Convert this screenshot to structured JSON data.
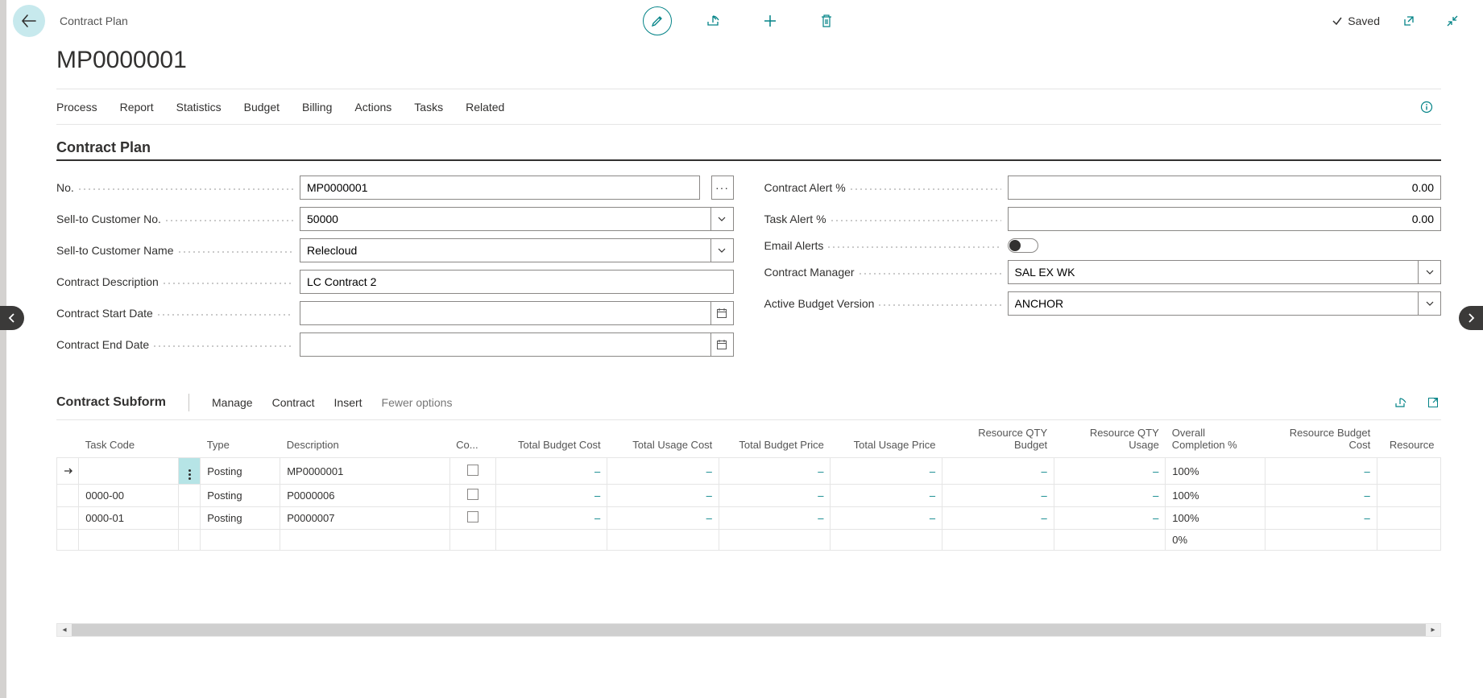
{
  "header": {
    "breadcrumb": "Contract Plan",
    "title": "MP0000001",
    "saved_label": "Saved"
  },
  "tabs": [
    "Process",
    "Report",
    "Statistics",
    "Budget",
    "Billing",
    "Actions",
    "Tasks",
    "Related"
  ],
  "section_title": "Contract Plan",
  "fields": {
    "no_label": "No.",
    "no_value": "MP0000001",
    "sell_to_no_label": "Sell-to Customer No.",
    "sell_to_no_value": "50000",
    "sell_to_name_label": "Sell-to Customer Name",
    "sell_to_name_value": "Relecloud",
    "desc_label": "Contract Description",
    "desc_value": "LC Contract 2",
    "start_label": "Contract Start Date",
    "start_value": "",
    "end_label": "Contract End Date",
    "end_value": "",
    "alert_label": "Contract Alert %",
    "alert_value": "0.00",
    "task_alert_label": "Task Alert %",
    "task_alert_value": "0.00",
    "email_label": "Email Alerts",
    "manager_label": "Contract Manager",
    "manager_value": "SAL EX WK",
    "budget_label": "Active Budget Version",
    "budget_value": "ANCHOR"
  },
  "subform": {
    "title": "Contract Subform",
    "actions": {
      "manage": "Manage",
      "contract": "Contract",
      "insert": "Insert",
      "fewer": "Fewer options"
    },
    "columns": {
      "task_code": "Task Code",
      "type": "Type",
      "description": "Description",
      "co": "Co...",
      "tbc": "Total Budget Cost",
      "tuc": "Total Usage Cost",
      "tbp": "Total Budget Price",
      "tup": "Total Usage Price",
      "rqb": "Resource QTY Budget",
      "rqu": "Resource QTY Usage",
      "ocp": "Overall Completion %",
      "rbc": "Resource Budget Cost",
      "res": "Resource"
    },
    "rows": [
      {
        "task_code": "",
        "type": "Posting",
        "description": "MP0000001",
        "co": false,
        "tbc": "–",
        "tuc": "–",
        "tbp": "–",
        "tup": "–",
        "rqb": "–",
        "rqu": "–",
        "ocp": "100%",
        "rbc": "–",
        "res": "",
        "selected": true
      },
      {
        "task_code": "0000-00",
        "type": "Posting",
        "description": "P0000006",
        "co": false,
        "tbc": "–",
        "tuc": "–",
        "tbp": "–",
        "tup": "–",
        "rqb": "–",
        "rqu": "–",
        "ocp": "100%",
        "rbc": "–",
        "res": ""
      },
      {
        "task_code": "0000-01",
        "type": "Posting",
        "description": "P0000007",
        "co": false,
        "tbc": "–",
        "tuc": "–",
        "tbp": "–",
        "tup": "–",
        "rqb": "–",
        "rqu": "–",
        "ocp": "100%",
        "rbc": "–",
        "res": ""
      },
      {
        "task_code": "",
        "type": "",
        "description": "",
        "co": null,
        "tbc": "",
        "tuc": "",
        "tbp": "",
        "tup": "",
        "rqb": "",
        "rqu": "",
        "ocp": "0%",
        "rbc": "",
        "res": ""
      }
    ]
  }
}
